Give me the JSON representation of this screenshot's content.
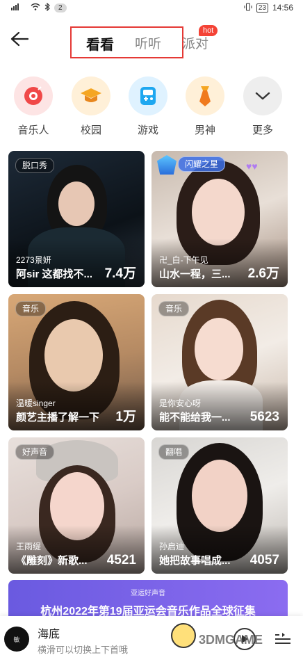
{
  "status_bar": {
    "left_badge": "2",
    "battery": "23",
    "time": "14:56"
  },
  "header": {
    "tabs": [
      {
        "label": "看看"
      },
      {
        "label": "听听"
      },
      {
        "label": "派对"
      }
    ],
    "hot_badge": "hot"
  },
  "categories": [
    {
      "label": "音乐人",
      "icon": "music-person-icon",
      "color": "#fde4e4"
    },
    {
      "label": "校园",
      "icon": "graduation-cap-icon",
      "color": "#fff0d8"
    },
    {
      "label": "游戏",
      "icon": "gamepad-icon",
      "color": "#dff2ff"
    },
    {
      "label": "男神",
      "icon": "tie-icon",
      "color": "#fff0d8"
    },
    {
      "label": "更多",
      "icon": "chevron-down-icon",
      "color": "#eeeeee"
    }
  ],
  "cards": [
    {
      "tag": "脱口秀",
      "user": "2273景妍",
      "title": "阿sir 这都找不...",
      "count": "7.4万"
    },
    {
      "tag": "闪耀之星",
      "user": "卍_白-下午见",
      "title": "山水一程，三...",
      "count": "2.6万"
    },
    {
      "tag": "音乐",
      "user": "温暖singer",
      "title": "颜艺主播了解一下",
      "count": "1万"
    },
    {
      "tag": "音乐",
      "user": "是你安心呀",
      "title": "能不能给我一...",
      "count": "5623"
    },
    {
      "tag": "好声音",
      "user": "王雨缇",
      "title": "《雕刻》新歌...",
      "count": "4521"
    },
    {
      "tag": "翻唱",
      "user": "孙启迪",
      "title": "她把故事唱成...",
      "count": "4057"
    }
  ],
  "banner": {
    "logo": "亚运好声音",
    "title": "杭州2022年第19届亚运会音乐作品全球征集"
  },
  "player": {
    "disc_text": "敏",
    "title": "海底",
    "subtitle": "横滑可以切换上下首哦"
  },
  "watermark": "3DMGAME"
}
